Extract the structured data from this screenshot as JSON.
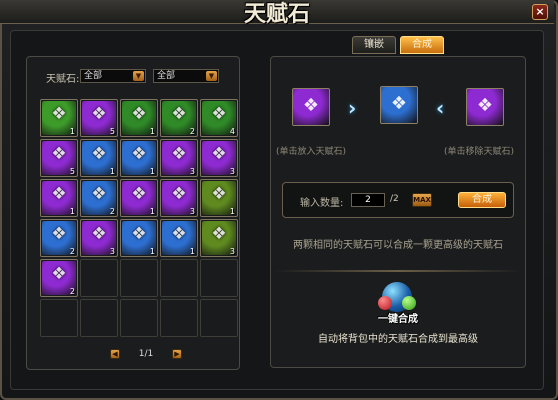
{
  "window": {
    "title": "天赋石",
    "close_icon": "close-icon"
  },
  "tabs": [
    {
      "label": "镶嵌",
      "active": false
    },
    {
      "label": "合成",
      "active": true
    }
  ],
  "filter": {
    "label": "天赋石:",
    "select1": "全部",
    "select2": "全部"
  },
  "inventory": {
    "slots": [
      {
        "icon": "gem-icon",
        "count": "1",
        "color": "#3d9b2a"
      },
      {
        "icon": "gem-icon",
        "count": "5",
        "color": "#8e2ad1"
      },
      {
        "icon": "gem-icon",
        "count": "1",
        "color": "#2f8a27"
      },
      {
        "icon": "gem-icon",
        "count": "2",
        "color": "#2f8a27"
      },
      {
        "icon": "gem-icon",
        "count": "4",
        "color": "#2f8a27"
      },
      {
        "icon": "gem-icon",
        "count": "5",
        "color": "#8e2ad1"
      },
      {
        "icon": "gem-icon",
        "count": "1",
        "color": "#2d6fd1"
      },
      {
        "icon": "gem-icon",
        "count": "1",
        "color": "#2d6fd1"
      },
      {
        "icon": "gem-icon",
        "count": "3",
        "color": "#8e2ad1"
      },
      {
        "icon": "gem-icon",
        "count": "3",
        "color": "#8e2ad1"
      },
      {
        "icon": "gem-icon",
        "count": "1",
        "color": "#8e2ad1"
      },
      {
        "icon": "gem-icon",
        "count": "2",
        "color": "#2d6fd1"
      },
      {
        "icon": "gem-icon",
        "count": "1",
        "color": "#8e2ad1"
      },
      {
        "icon": "gem-icon",
        "count": "3",
        "color": "#8e2ad1"
      },
      {
        "icon": "gem-icon",
        "count": "1",
        "color": "#5e8a1f"
      },
      {
        "icon": "gem-icon",
        "count": "2",
        "color": "#2d6fd1"
      },
      {
        "icon": "gem-icon",
        "count": "3",
        "color": "#8e2ad1"
      },
      {
        "icon": "gem-icon",
        "count": "1",
        "color": "#2d6fd1"
      },
      {
        "icon": "gem-icon",
        "count": "1",
        "color": "#2d6fd1"
      },
      {
        "icon": "gem-icon",
        "count": "3",
        "color": "#5e8a1f"
      },
      {
        "icon": "gem-icon",
        "count": "2",
        "color": "#8e2ad1"
      }
    ],
    "total_slots": 30
  },
  "pager": {
    "text": "1/1"
  },
  "synth": {
    "hint_left": "(单击放入天赋石)",
    "hint_right": "(单击移除天赋石)",
    "left_color": "#8e2ad1",
    "center_color": "#2d6fd1",
    "right_color": "#8e2ad1",
    "qty_label": "输入数量:",
    "qty_value": "2",
    "qty_max_text": "/2",
    "max_label": "MAX",
    "synth_button": "合成",
    "info": "两颗相同的天赋石可以合成一颗更高级的天赋石"
  },
  "onekey": {
    "label": "一键合成",
    "desc": "自动将背包中的天赋石合成到最高级"
  }
}
